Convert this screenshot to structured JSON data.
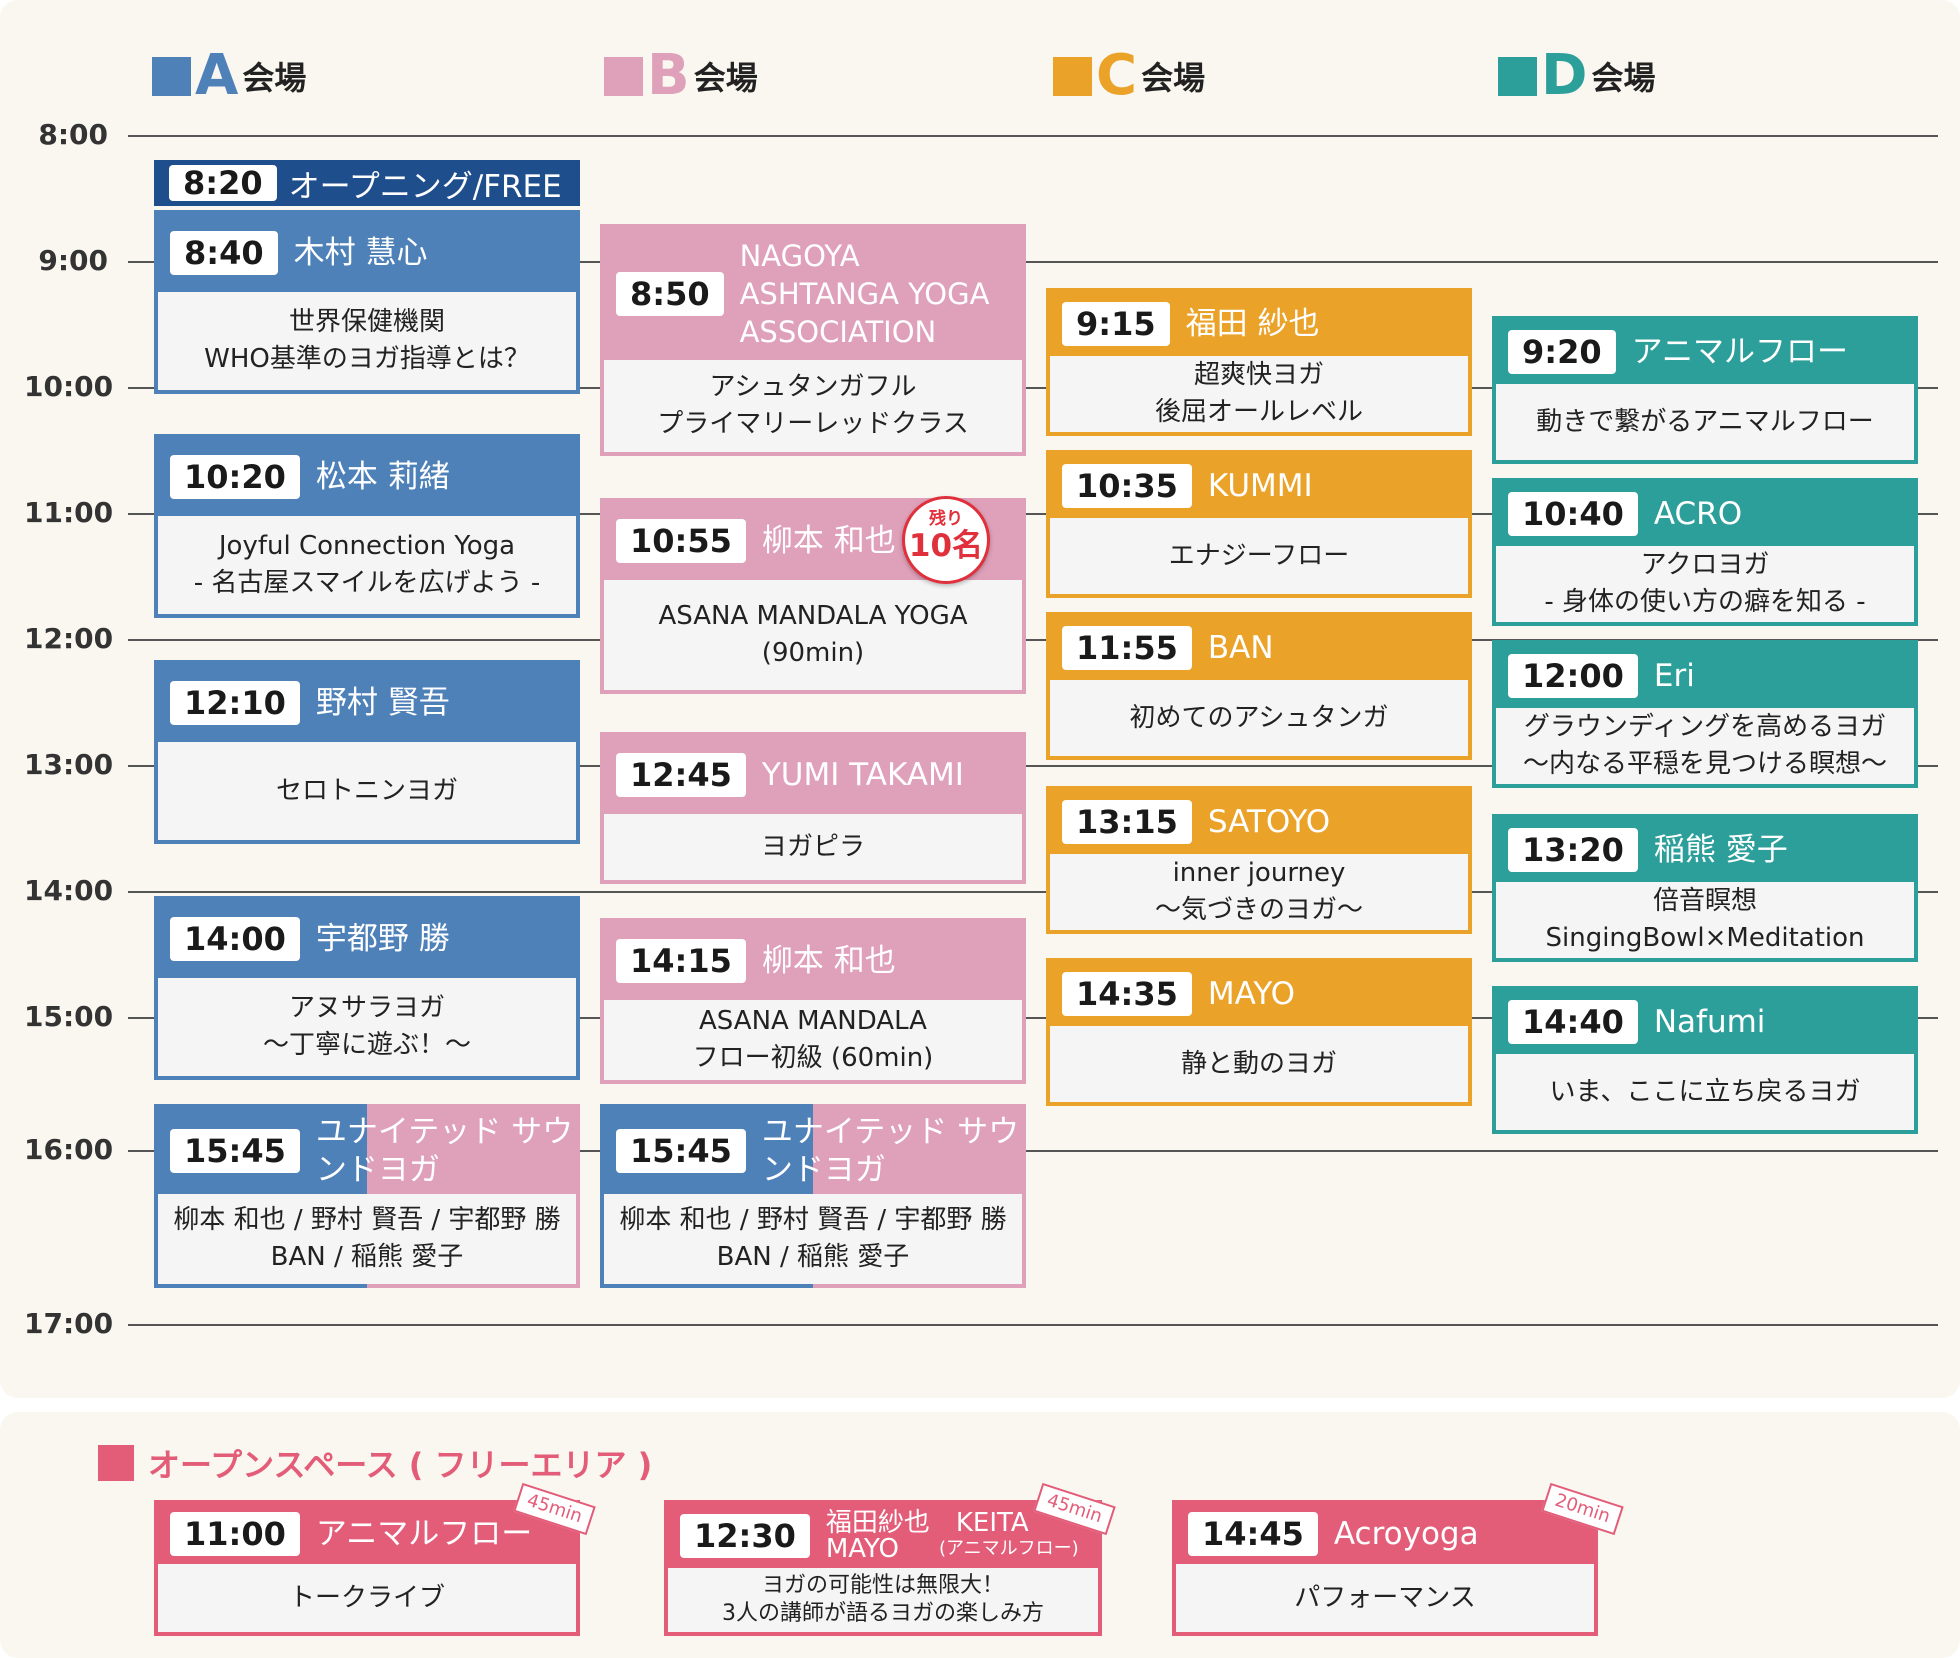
{
  "venues": [
    {
      "letter": "A",
      "word": "会場",
      "color": "#4f81b9"
    },
    {
      "letter": "B",
      "word": "会場",
      "color": "#dfa0b9"
    },
    {
      "letter": "C",
      "word": "会場",
      "color": "#eba229"
    },
    {
      "letter": "D",
      "word": "会場",
      "color": "#2c9f9b"
    }
  ],
  "times": [
    "8:00",
    "9:00",
    "10:00",
    "11:00",
    "12:00",
    "13:00",
    "14:00",
    "15:00",
    "16:00",
    "17:00"
  ],
  "opening": {
    "time": "8:20",
    "title": "オープニング/FREE",
    "color": "#1f4e8c"
  },
  "sessions": [
    {
      "venue": "A",
      "time": "8:40",
      "who": "木村 慧心",
      "lines": [
        "世界保健機関",
        "WHO基準のヨガ指導とは？"
      ]
    },
    {
      "venue": "A",
      "time": "10:20",
      "who": "松本 莉緒",
      "lines": [
        "Joyful Connection Yoga",
        "- 名古屋スマイルを広げよう -"
      ]
    },
    {
      "venue": "A",
      "time": "12:10",
      "who": "野村 賢吾",
      "lines": [
        "セロトニンヨガ"
      ]
    },
    {
      "venue": "A",
      "time": "14:00",
      "who": "宇都野 勝",
      "lines": [
        "アヌサラヨガ",
        "～丁寧に遊ぶ！～"
      ]
    },
    {
      "venue": "A",
      "time": "15:45",
      "who": "ユナイテッド サウンドヨガ",
      "lines": [
        "柳本 和也 / 野村 賢吾 / 宇都野 勝",
        "BAN / 稲熊 愛子"
      ]
    },
    {
      "venue": "B",
      "time": "8:50",
      "who": "NAGOYA ASHTANGA YOGA ASSOCIATION",
      "lines": [
        "アシュタンガフル",
        "プライマリーレッドクラス"
      ]
    },
    {
      "venue": "B",
      "time": "10:55",
      "who": "柳本 和也",
      "lines": [
        "ASANA MANDALA YOGA",
        "(90min)"
      ],
      "badge": {
        "top": "残り",
        "main": "10名"
      }
    },
    {
      "venue": "B",
      "time": "12:45",
      "who": "YUMI TAKAMI",
      "lines": [
        "ヨガピラ"
      ]
    },
    {
      "venue": "B",
      "time": "14:15",
      "who": "柳本 和也",
      "lines": [
        "ASANA MANDALA",
        "フロー初級 (60min)"
      ]
    },
    {
      "venue": "B",
      "time": "15:45",
      "who": "ユナイテッド サウンドヨガ",
      "lines": [
        "柳本 和也 / 野村 賢吾 / 宇都野 勝",
        "BAN / 稲熊 愛子"
      ]
    },
    {
      "venue": "C",
      "time": "9:15",
      "who": "福田 紗也",
      "lines": [
        "超爽快ヨガ",
        "後屈オールレベル"
      ]
    },
    {
      "venue": "C",
      "time": "10:35",
      "who": "KUMMI",
      "lines": [
        "エナジーフロー"
      ]
    },
    {
      "venue": "C",
      "time": "11:55",
      "who": "BAN",
      "lines": [
        "初めてのアシュタンガ"
      ]
    },
    {
      "venue": "C",
      "time": "13:15",
      "who": "SATOYO",
      "lines": [
        "inner journey",
        "～気づきのヨガ～"
      ]
    },
    {
      "venue": "C",
      "time": "14:35",
      "who": "MAYO",
      "lines": [
        "静と動のヨガ"
      ]
    },
    {
      "venue": "D",
      "time": "9:20",
      "who": "アニマルフロー",
      "lines": [
        "動きで繋がるアニマルフロー"
      ]
    },
    {
      "venue": "D",
      "time": "10:40",
      "who": "ACRO",
      "lines": [
        "アクロヨガ",
        "- 身体の使い方の癖を知る -"
      ]
    },
    {
      "venue": "D",
      "time": "12:00",
      "who": "Eri",
      "lines": [
        "グラウンディングを高めるヨガ",
        "～内なる平穏を見つける瞑想～"
      ]
    },
    {
      "venue": "D",
      "time": "13:20",
      "who": "稲熊 愛子",
      "lines": [
        "倍音瞑想",
        "SingingBowl×Meditation"
      ]
    },
    {
      "venue": "D",
      "time": "14:40",
      "who": "Nafumi",
      "lines": [
        "いま、ここに立ち戻るヨガ"
      ]
    }
  ],
  "open_space": {
    "title": "オープンスペース ( フリーエリア )",
    "color": "#e35d79",
    "items": [
      {
        "time": "11:00",
        "who": "アニマルフロー",
        "tag": "45min",
        "lines": [
          "トークライブ"
        ]
      },
      {
        "time": "12:30",
        "who": "福田紗也　KEITA",
        "who2": "MAYO",
        "who_sub": "(アニマルフロー)",
        "tag": "45min",
        "lines": [
          "ヨガの可能性は無限大！",
          "3人の講師が語るヨガの楽しみ方"
        ]
      },
      {
        "time": "14:45",
        "who": "Acroyoga",
        "tag": "20min",
        "lines": [
          "パフォーマンス"
        ]
      }
    ]
  }
}
